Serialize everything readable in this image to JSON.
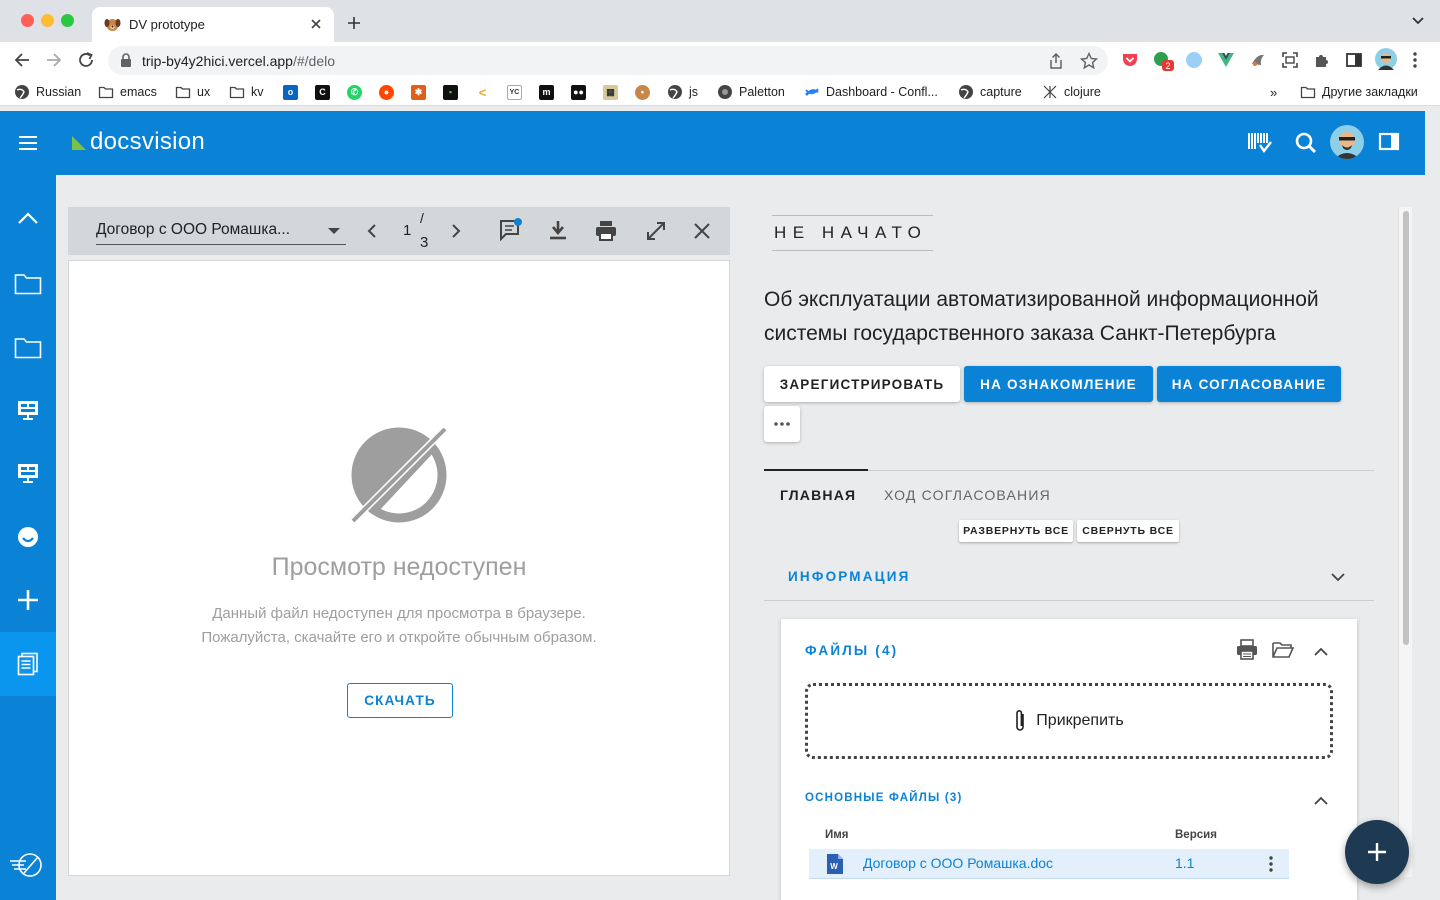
{
  "browser": {
    "tab_title": "DV prototype",
    "url_host": "trip-by4y2hici.vercel.app",
    "url_path": "/#/delo",
    "bookmarks": [
      "Russian",
      "emacs",
      "ux",
      "kv",
      "js",
      "Paletton",
      "Dashboard - Confl...",
      "capture",
      "clojure"
    ],
    "other_bookmarks": "Другие закладки",
    "extension_badge": "2"
  },
  "app": {
    "brand": "docsvision",
    "brand_color": "#0a82d6",
    "accent_green": "#7cc243"
  },
  "rail": {
    "items": [
      "collapse-icon",
      "folder-icon",
      "folder-icon",
      "monitor-icon",
      "monitor-icon",
      "smiley-icon",
      "plus-icon",
      "document-icon",
      "logo-icon"
    ]
  },
  "viewer": {
    "document_name": "Договор с ООО Ромашка...",
    "page_current": "1",
    "page_sep": "/",
    "page_total": "3",
    "unavailable_title": "Просмотр недоступен",
    "unavailable_line1": "Данный файл недоступен для просмотра в браузере.",
    "unavailable_line2": "Пожалуйста, скачайте его и откройте обычным образом.",
    "download_label": "СКАЧАТЬ"
  },
  "card": {
    "status": "НЕ НАЧАТО",
    "title": "Об эксплуатации автоматизированной информационной системы государственного заказа Санкт-Петербурга",
    "btn_register": "ЗАРЕГИСТРИРОВАТЬ",
    "btn_review": "НА ОЗНАКОМЛЕНИЕ",
    "btn_approve": "НА СОГЛАСОВАНИЕ",
    "tab_main": "ГЛАВНАЯ",
    "tab_progress": "ХОД СОГЛАСОВАНИЯ",
    "expand_all": "РАЗВЕРНУТЬ ВСЕ",
    "collapse_all": "СВЕРНУТЬ ВСЕ",
    "info_section": "ИНФОРМАЦИЯ",
    "files_section": "ФАЙЛЫ (4)",
    "attach_label": "Прикрепить",
    "main_files": "ОСНОВНЫЕ ФАЙЛЫ (3)",
    "col_name": "Имя",
    "col_version": "Версия",
    "files": [
      {
        "name": "Договор с ООО Ромашка.doc",
        "version": "1.1"
      }
    ]
  }
}
